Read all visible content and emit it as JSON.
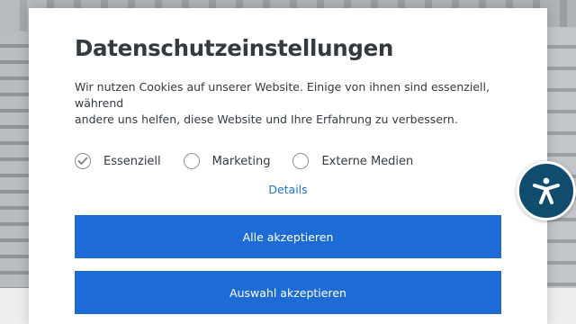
{
  "consent_modal": {
    "title": "Datenschutzeinstellungen",
    "description_line1": "Wir nutzen Cookies auf unserer Website. Einige von ihnen sind essenziell,",
    "description_line2": "während",
    "description_line3": "andere uns helfen, diese Website und Ihre Erfahrung zu verbessern.",
    "options": [
      {
        "label": "Essenziell",
        "checked": true
      },
      {
        "label": "Marketing",
        "checked": false
      },
      {
        "label": "Externe Medien",
        "checked": false
      }
    ],
    "details_link": "Details",
    "accept_all_label": "Alle akzeptieren",
    "accept_selection_label": "Auswahl akzeptieren"
  },
  "accessibility_button": {
    "icon": "accessibility-person-icon"
  },
  "colors": {
    "primary_button": "#1d6cd6",
    "link": "#1e6fd9",
    "text": "#333a40",
    "accessibility_badge": "#0f4c6e"
  }
}
